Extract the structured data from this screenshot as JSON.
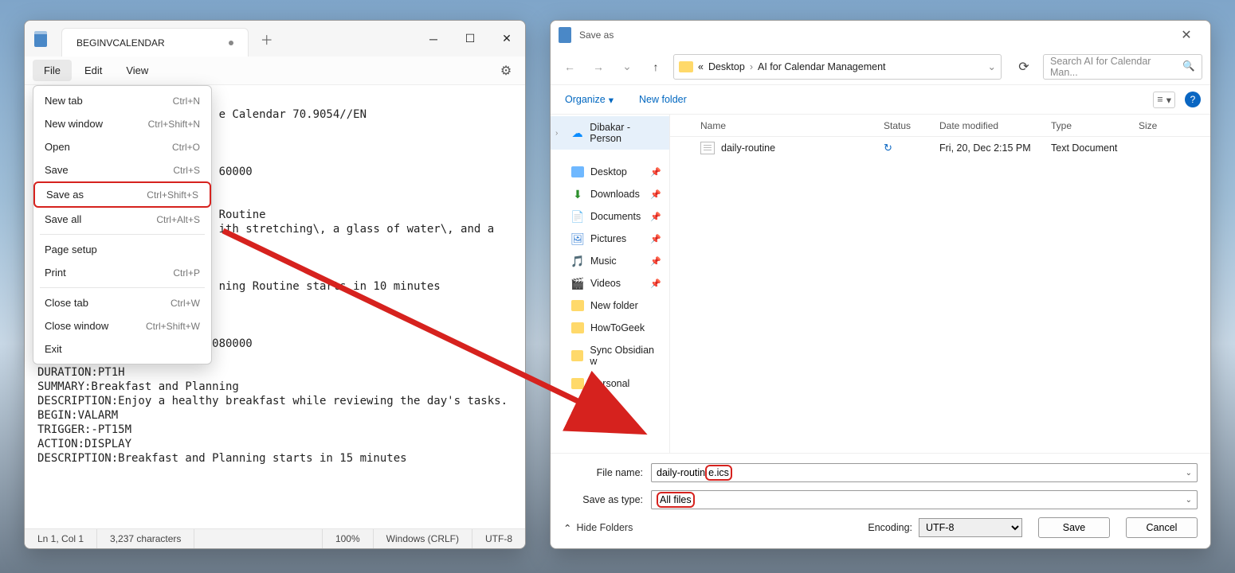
{
  "notepad": {
    "tab_title": "BEGINVCALENDAR",
    "menus": {
      "file": "File",
      "edit": "Edit",
      "view": "View"
    },
    "dropdown": [
      {
        "label": "New tab",
        "shortcut": "Ctrl+N"
      },
      {
        "label": "New window",
        "shortcut": "Ctrl+Shift+N"
      },
      {
        "label": "Open",
        "shortcut": "Ctrl+O"
      },
      {
        "label": "Save",
        "shortcut": "Ctrl+S"
      },
      {
        "label": "Save as",
        "shortcut": "Ctrl+Shift+S",
        "highlighted": true
      },
      {
        "label": "Save all",
        "shortcut": "Ctrl+Alt+S"
      },
      {
        "sep": true
      },
      {
        "label": "Page setup",
        "shortcut": ""
      },
      {
        "label": "Print",
        "shortcut": "Ctrl+P"
      },
      {
        "sep": true
      },
      {
        "label": "Close tab",
        "shortcut": "Ctrl+W"
      },
      {
        "label": "Close window",
        "shortcut": "Ctrl+Shift+W"
      },
      {
        "label": "Exit",
        "shortcut": ""
      }
    ],
    "body_text": "\n                           e Calendar 70.9054//EN\n\n\n\n                           60000\n\n\n                           Routine\n                           ith stretching\\, a glass of water\\, and a\n\n\n\n                           ning Routine starts in 10 minutes\n\n\nBEGIN:VEVENT\nDTSTART;TZID=UTC:20241221T080000\nRRULE:FREQ=DAILY\nDURATION:PT1H\nSUMMARY:Breakfast and Planning\nDESCRIPTION:Enjoy a healthy breakfast while reviewing the day's tasks.\nBEGIN:VALARM\nTRIGGER:-PT15M\nACTION:DISPLAY\nDESCRIPTION:Breakfast and Planning starts in 15 minutes",
    "status": {
      "pos": "Ln 1, Col 1",
      "chars": "3,237 characters",
      "zoom": "100%",
      "eol": "Windows (CRLF)",
      "enc": "UTF-8"
    }
  },
  "saveas": {
    "title": "Save as",
    "breadcrumb": {
      "p1": "«",
      "p2": "Desktop",
      "p3": "AI for Calendar Management"
    },
    "search_placeholder": "Search AI for Calendar Man...",
    "toolbar": {
      "organize": "Organize",
      "newfolder": "New folder"
    },
    "sidebar": [
      {
        "label": "Dibakar - Person",
        "icon": "cloud",
        "chev": true,
        "selected": true
      },
      {
        "label": "Desktop",
        "icon": "desk",
        "pin": true
      },
      {
        "label": "Downloads",
        "icon": "dl",
        "pin": true
      },
      {
        "label": "Documents",
        "icon": "doc",
        "pin": true
      },
      {
        "label": "Pictures",
        "icon": "pic",
        "pin": true
      },
      {
        "label": "Music",
        "icon": "mus",
        "pin": true
      },
      {
        "label": "Videos",
        "icon": "vid",
        "pin": true
      },
      {
        "label": "New folder",
        "icon": "folder"
      },
      {
        "label": "HowToGeek",
        "icon": "folder"
      },
      {
        "label": "Sync Obsidian w",
        "icon": "folder"
      },
      {
        "label": "Personal",
        "icon": "folder"
      }
    ],
    "columns": {
      "name": "Name",
      "status": "Status",
      "date": "Date modified",
      "type": "Type",
      "size": "Size"
    },
    "files": [
      {
        "name": "daily-routine",
        "status": "↻",
        "date": "Fri, 20, Dec 2:15 PM",
        "type": "Text Document",
        "size": ""
      }
    ],
    "filename_label": "File name:",
    "filename_prefix": "daily-routin",
    "filename_highlight": "e.ics",
    "saveastype_label": "Save as type:",
    "saveastype_value": "All files",
    "hide_folders": "Hide Folders",
    "encoding_label": "Encoding:",
    "encoding_value": "UTF-8",
    "save_btn": "Save",
    "cancel_btn": "Cancel"
  }
}
